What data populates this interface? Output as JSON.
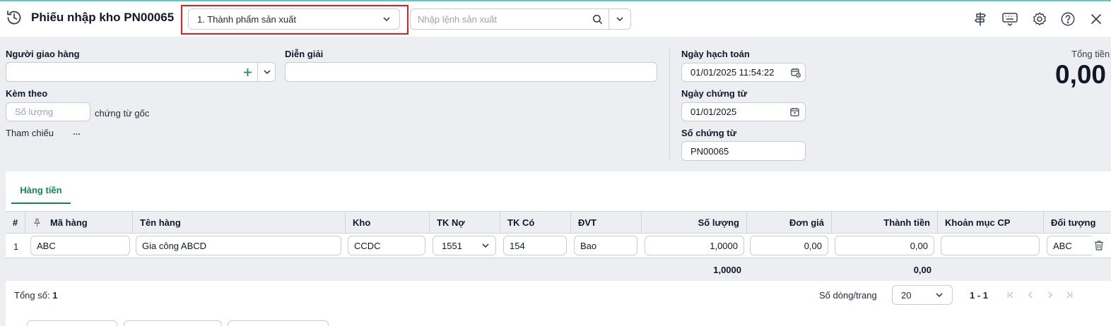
{
  "header": {
    "title": "Phiếu nhập kho PN00065",
    "type_select_value": "1. Thành phẩm sản xuất",
    "order_placeholder": "Nhập lệnh sản xuất",
    "icons": [
      "history-icon",
      "signpost-icon",
      "keyboard-icon",
      "gear-icon",
      "help-icon",
      "close-icon"
    ]
  },
  "form": {
    "deliverer_label": "Người giao hàng",
    "deliverer_value": "",
    "description_label": "Diễn giải",
    "description_value": "",
    "attached_label": "Kèm theo",
    "attached_placeholder": "Số lượng",
    "original_docs_text": "chứng từ gốc",
    "reference_label": "Tham chiếu",
    "reference_link": "...",
    "accounting_date_label": "Ngày hạch toán",
    "accounting_date_value": "01/01/2025 11:54:22",
    "voucher_date_label": "Ngày chứng từ",
    "voucher_date_value": "01/01/2025",
    "voucher_no_label": "Số chứng từ",
    "voucher_no_value": "PN00065",
    "total_label": "Tổng tiền",
    "total_value": "0,00"
  },
  "tabs": [
    {
      "label": "Hàng tiền",
      "active": true
    }
  ],
  "table": {
    "columns": [
      "#",
      "Mã hàng",
      "Tên hàng",
      "Kho",
      "TK Nợ",
      "TK Có",
      "ĐVT",
      "Số lượng",
      "Đơn giá",
      "Thành tiền",
      "Khoản mục CP",
      "Đối tượng"
    ],
    "rows": [
      {
        "no": "1",
        "item_code": "ABC",
        "item_name": "Gia công ABCD",
        "warehouse": "CCDC",
        "debit_account": "1551",
        "credit_account": "154",
        "unit": "Bao",
        "quantity": "1,0000",
        "unit_price": "0,00",
        "amount": "0,00",
        "cost_item": "",
        "object": "ABC"
      }
    ],
    "totals": {
      "quantity": "1,0000",
      "amount": "0,00"
    }
  },
  "footer": {
    "total_count_label": "Tổng số:",
    "total_count_value": "1",
    "rows_per_page_label": "Số dòng/trang",
    "rows_per_page_value": "20",
    "range": "1 - 1"
  },
  "colors": {
    "accent": "#0f8a4f",
    "highlight_border": "#e11d1d",
    "top_line": "#5cc9c9"
  }
}
